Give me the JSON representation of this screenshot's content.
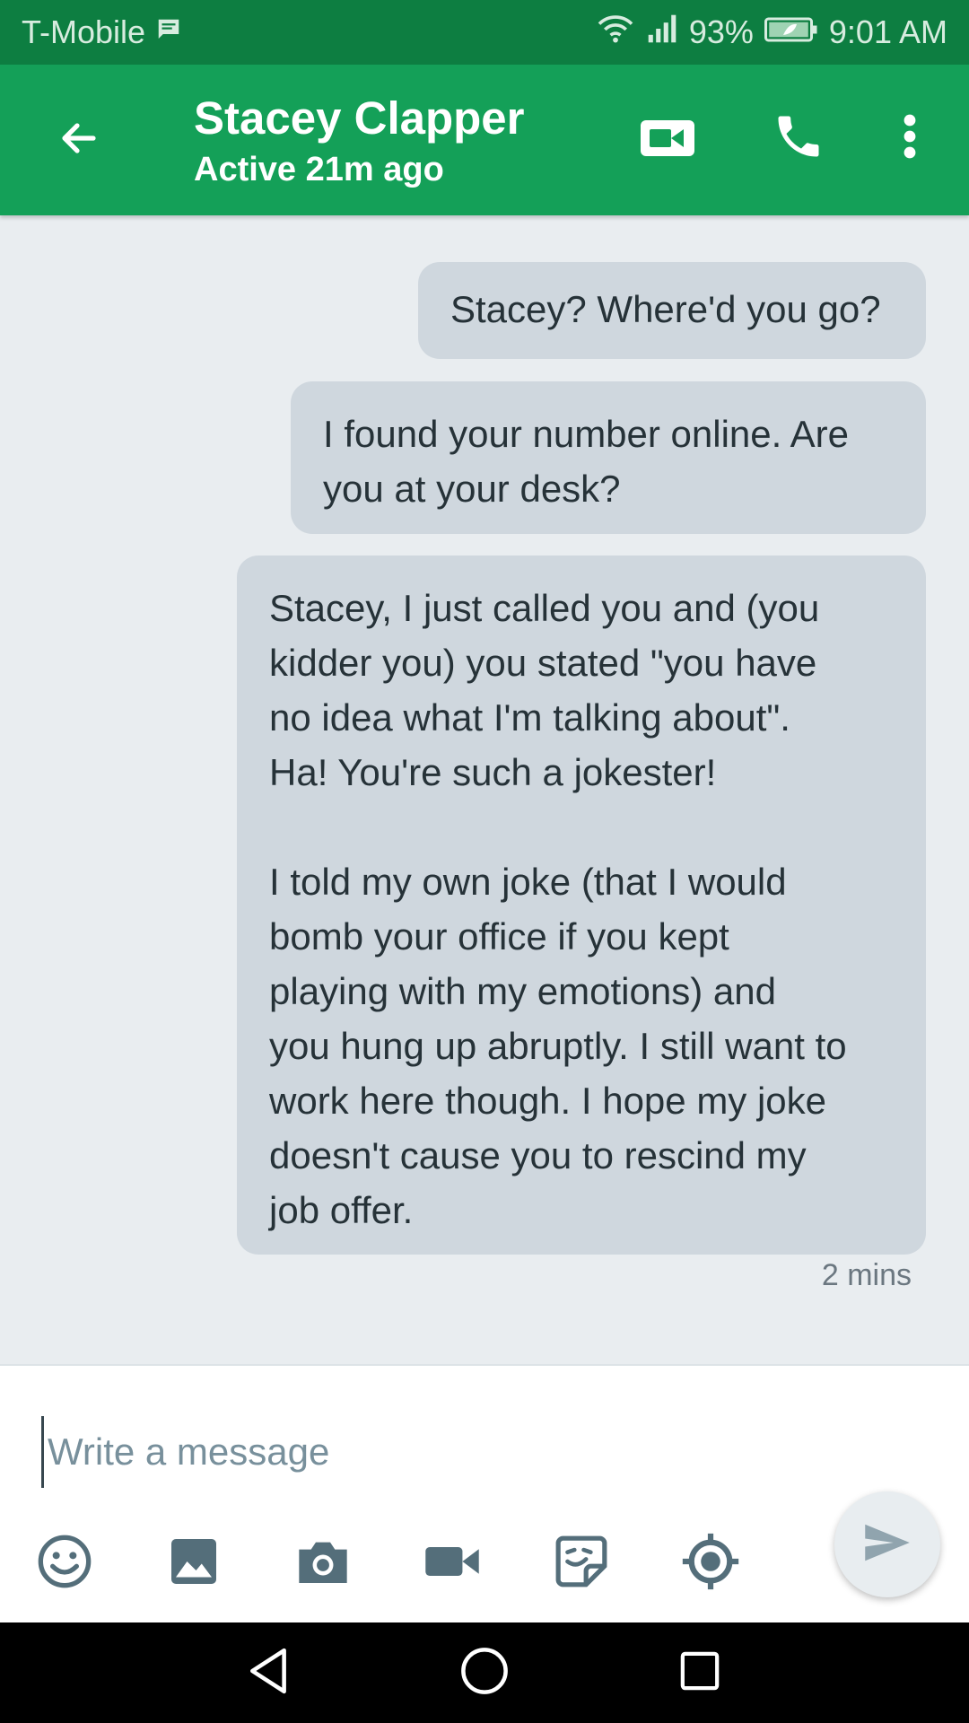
{
  "status_bar": {
    "carrier": "T-Mobile",
    "battery": "93%",
    "time": "9:01 AM",
    "icons": [
      "message-notification-icon",
      "wifi-icon",
      "signal-icon",
      "battery-saver-icon"
    ]
  },
  "header": {
    "contact_name": "Stacey Clapper",
    "contact_status": "Active 21m ago",
    "icons": [
      "back-arrow-icon",
      "video-call-icon",
      "phone-icon",
      "more-vert-icon"
    ]
  },
  "messages": [
    {
      "direction": "outgoing",
      "text": "Stacey? Where'd you go?"
    },
    {
      "direction": "outgoing",
      "text": "I found your number online. Are\nyou at your desk?"
    },
    {
      "direction": "outgoing",
      "text": "Stacey, I just called you and (you\nkidder you) you stated \"you have\nno idea what I'm talking about\".\nHa! You're such a jokester!\n\nI told my own joke (that I would\nbomb your office if you kept\nplaying with my emotions) and\nyou hung up abruptly. I still want to\nwork here though. I hope my joke\ndoesn't cause you to rescind my\njob offer."
    }
  ],
  "last_message_time": "2 mins",
  "composer": {
    "placeholder": "Write a message",
    "value": "",
    "tools": [
      "emoji-icon",
      "image-icon",
      "camera-icon",
      "video-icon",
      "sticker-icon",
      "location-icon",
      "send-icon"
    ]
  },
  "nav_bar": {
    "icons": [
      "back-triangle-icon",
      "home-circle-icon",
      "recents-square-icon"
    ]
  },
  "colors": {
    "status_bar": "#0d7e41",
    "app_bar": "#14a058",
    "background": "#e9edf0",
    "bubble": "#cfd7de",
    "icon_gray": "#546e7a"
  }
}
